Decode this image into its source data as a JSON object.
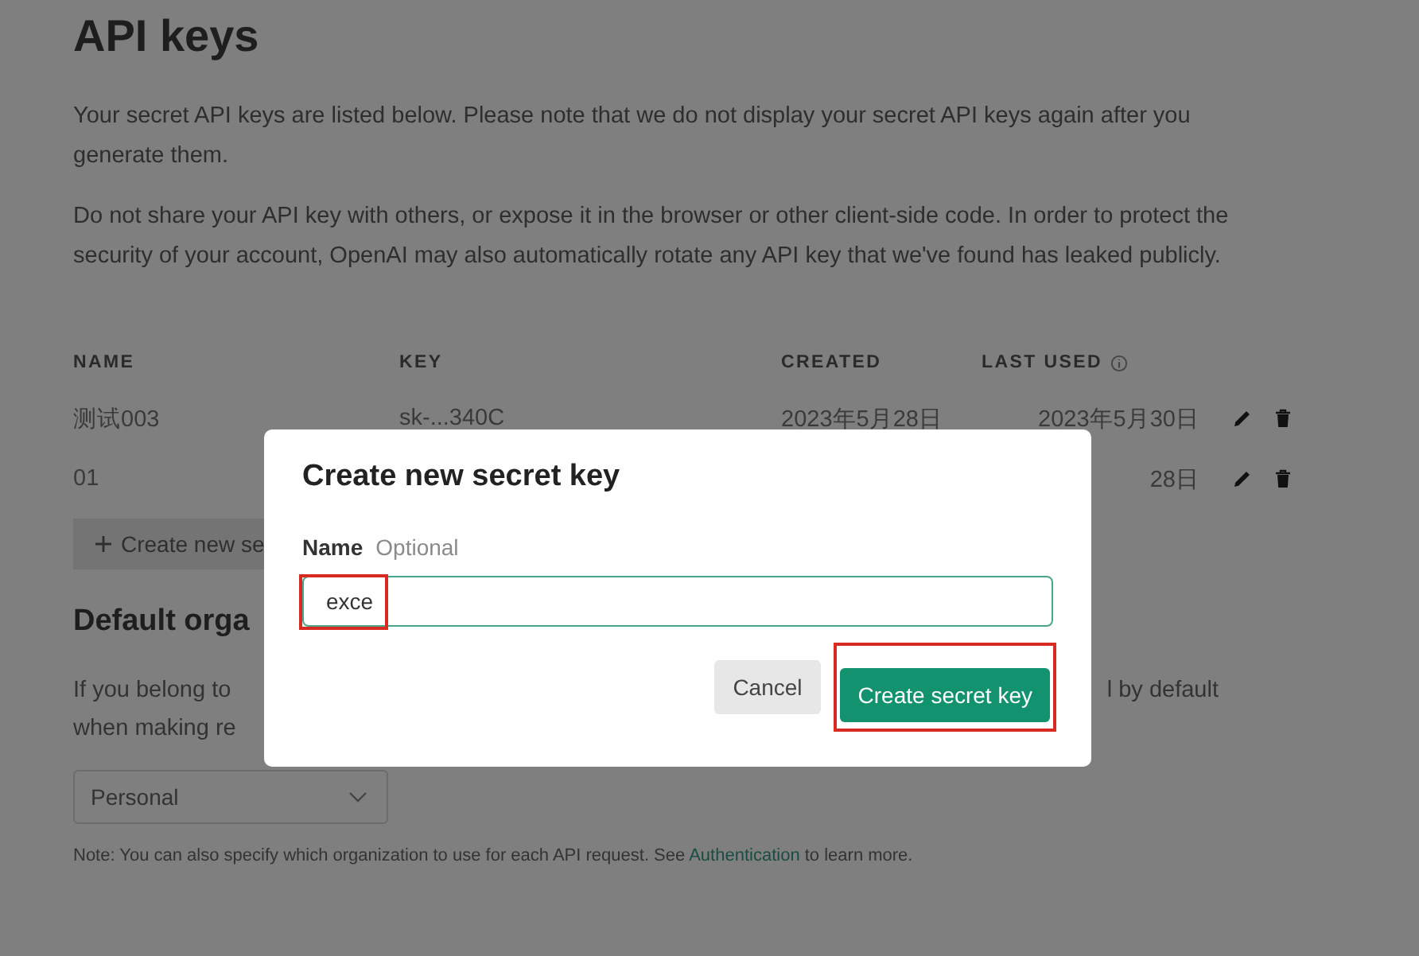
{
  "page": {
    "title": "API keys",
    "paragraphs": [
      "Your secret API keys are listed below. Please note that we do not display your secret API keys again after you generate them.",
      "Do not share your API key with others, or expose it in the browser or other client-side code. In order to protect the security of your account, OpenAI may also automatically rotate any API key that we've found has leaked publicly."
    ],
    "table": {
      "columns": [
        "NAME",
        "KEY",
        "CREATED",
        "LAST USED"
      ],
      "rows": [
        {
          "name": "测试003",
          "key": "sk-...340C",
          "created": "2023年5月28日",
          "last_used": "2023年5月30日"
        },
        {
          "name": "01",
          "last_used": "28日"
        }
      ]
    },
    "create_button": "Create new se",
    "default_org": {
      "heading": "Default orga",
      "text_start": "If you belong to",
      "text_end": "l by default",
      "text_line2": "when making re",
      "select": "Personal",
      "note_before": "Note: You can also specify which organization to use for each API request. See",
      "note_link": "Authentication",
      "note_after": "to learn more."
    }
  },
  "dialog": {
    "title": "Create new secret key",
    "field_label": "Name",
    "field_hint": "Optional",
    "field_value": "exce",
    "field_highlighted": true,
    "buttons": [
      {
        "label": "Cancel",
        "kind": "secondary",
        "highlighted": false
      },
      {
        "label": "Create secret key",
        "kind": "primary",
        "highlighted": true
      }
    ]
  }
}
